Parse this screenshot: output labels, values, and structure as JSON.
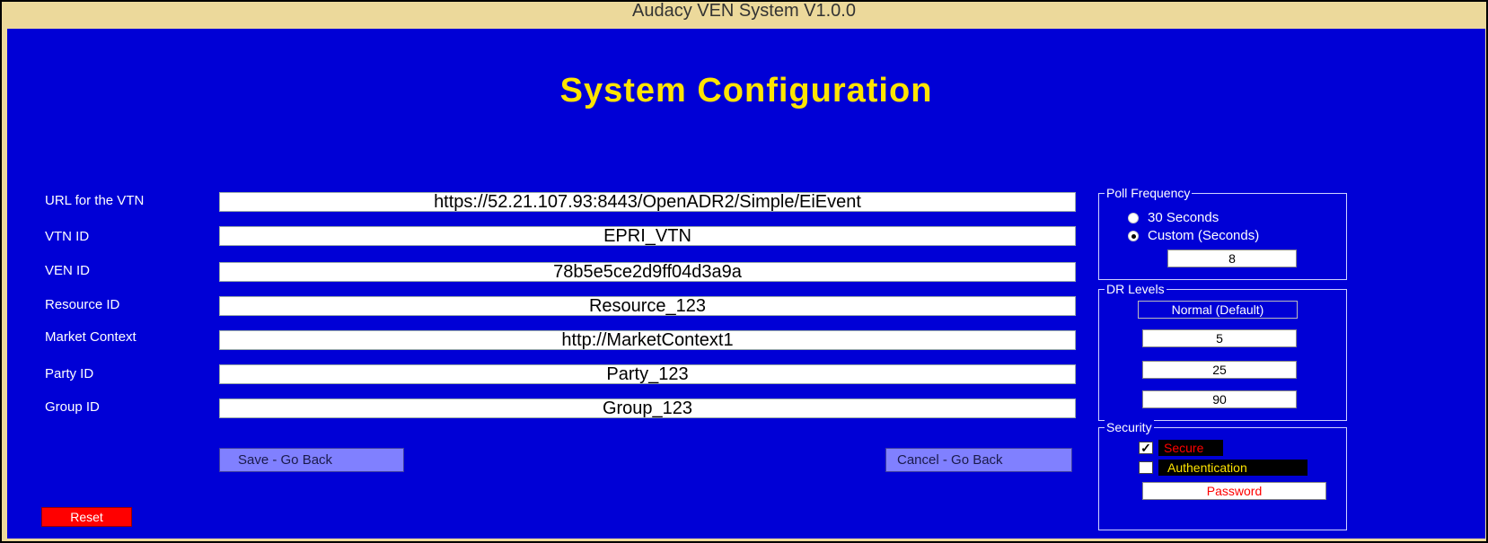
{
  "window": {
    "title": "Audacy VEN System V1.0.0"
  },
  "heading": "System Configuration",
  "fields": [
    {
      "label": "URL for the VTN",
      "value": "https://52.21.107.93:8443/OpenADR2/Simple/EiEvent"
    },
    {
      "label": "VTN ID",
      "value": "EPRI_VTN"
    },
    {
      "label": "VEN ID",
      "value": "78b5e5ce2d9ff04d3a9a"
    },
    {
      "label": "Resource ID",
      "value": "Resource_123"
    },
    {
      "label": "Market Context",
      "value": "http://MarketContext1"
    },
    {
      "label": "Party ID",
      "value": "Party_123"
    },
    {
      "label": "Group ID",
      "value": "Group_123"
    }
  ],
  "buttons": {
    "save": "Save - Go Back",
    "cancel": "Cancel - Go Back",
    "reset": "Reset"
  },
  "poll_frequency": {
    "title": "Poll Frequency",
    "option_30": "30 Seconds",
    "option_custom": "Custom (Seconds)",
    "selected": "Custom (Seconds)",
    "custom_value": "8"
  },
  "dr_levels": {
    "title": "DR Levels",
    "mode": "Normal (Default)",
    "values": [
      "5",
      "25",
      "90"
    ]
  },
  "security": {
    "title": "Security",
    "secure_label": "Secure",
    "secure_checked": true,
    "auth_label": "Authentication",
    "auth_checked": false,
    "password_label": "Password"
  },
  "colors": {
    "background": "#0000d6",
    "heading": "#ffe400",
    "button": "#8080ff",
    "reset": "#ff0000",
    "frame": "#ecd99b"
  }
}
